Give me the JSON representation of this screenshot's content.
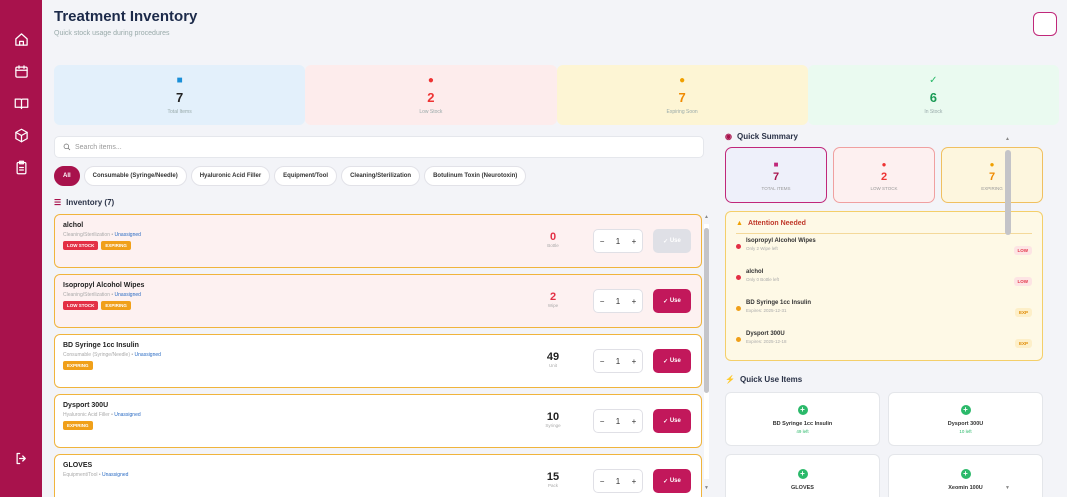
{
  "sidebar": {
    "items": [
      "home-icon",
      "calendar-icon",
      "book-icon",
      "box-icon",
      "clipboard-icon"
    ],
    "logout": "logout-icon"
  },
  "header": {
    "title": "Treatment Inventory",
    "subtitle": "Quick stock usage during procedures"
  },
  "stats": [
    {
      "icon": "cube-icon",
      "value": "7",
      "label": "Total Items"
    },
    {
      "icon": "alert-icon",
      "value": "2",
      "label": "Low Stock"
    },
    {
      "icon": "clock-icon",
      "value": "7",
      "label": "Expiring Soon"
    },
    {
      "icon": "check-icon",
      "value": "6",
      "label": "In Stock"
    }
  ],
  "search": {
    "placeholder": "Search items..."
  },
  "filters": [
    "All",
    "Consumable (Syringe/Needle)",
    "Hyaluronic Acid Filler",
    "Equipment/Tool",
    "Cleaning/Sterilization",
    "Botulinum Toxin (Neurotoxin)"
  ],
  "inventory": {
    "heading": "Inventory (7)",
    "use_label": "Use",
    "items": [
      {
        "name": "alchol",
        "category": "Cleaning/Sterilization",
        "assignee": "Unassigned",
        "low": "LOW STOCK",
        "expiring": "EXPIRING",
        "qty": "0",
        "unit": "Bottle",
        "step": "1"
      },
      {
        "name": "Isopropyl Alcohol Wipes",
        "category": "Cleaning/Sterilization",
        "assignee": "Unassigned",
        "low": "LOW STOCK",
        "expiring": "EXPIRING",
        "qty": "2",
        "unit": "Wipe",
        "step": "1"
      },
      {
        "name": "BD Syringe 1cc Insulin",
        "category": "Consumable (Syringe/Needle)",
        "assignee": "Unassigned",
        "expiring": "EXPIRING",
        "qty": "49",
        "unit": "Unit",
        "step": "1"
      },
      {
        "name": "Dysport 300U",
        "category": "Hyaluronic Acid Filler",
        "assignee": "Unassigned",
        "expiring": "EXPIRING",
        "qty": "10",
        "unit": "Syringe",
        "step": "1"
      },
      {
        "name": "GLOVES",
        "category": "Equipment/Tool",
        "assignee": "Unassigned",
        "qty": "15",
        "unit": "Pack",
        "step": "1"
      }
    ]
  },
  "quick_summary": {
    "heading": "Quick Summary",
    "cards": [
      {
        "value": "7",
        "label": "TOTAL ITEMS"
      },
      {
        "value": "2",
        "label": "LOW STOCK"
      },
      {
        "value": "7",
        "label": "EXPIRING"
      }
    ]
  },
  "attention": {
    "heading": "Attention Needed",
    "rows": [
      {
        "title": "Isopropyl Alcohol Wipes",
        "sub": "Only 2 Wipe left",
        "tag": "LOW",
        "kind": "low"
      },
      {
        "title": "alchol",
        "sub": "Only 0 Bottle left",
        "tag": "LOW",
        "kind": "low"
      },
      {
        "title": "BD Syringe 1cc Insulin",
        "sub": "Expires: 2025-12-31",
        "tag": "EXP",
        "kind": "exp"
      },
      {
        "title": "Dysport 300U",
        "sub": "Expires: 2025-12-18",
        "tag": "EXP",
        "kind": "exp"
      }
    ]
  },
  "quick_use": {
    "heading": "Quick Use Items",
    "items": [
      {
        "name": "BD Syringe 1cc Insulin",
        "left": "49 left"
      },
      {
        "name": "Dysport 300U",
        "left": "10 left"
      },
      {
        "name": "GLOVES",
        "left": ""
      },
      {
        "name": "Xeomin 100U",
        "left": ""
      }
    ]
  },
  "colors": {
    "brand": "#a8124c",
    "use": "#c2185b",
    "warn": "#f0b43c",
    "danger": "#e33045",
    "ok": "#2bb96a"
  }
}
